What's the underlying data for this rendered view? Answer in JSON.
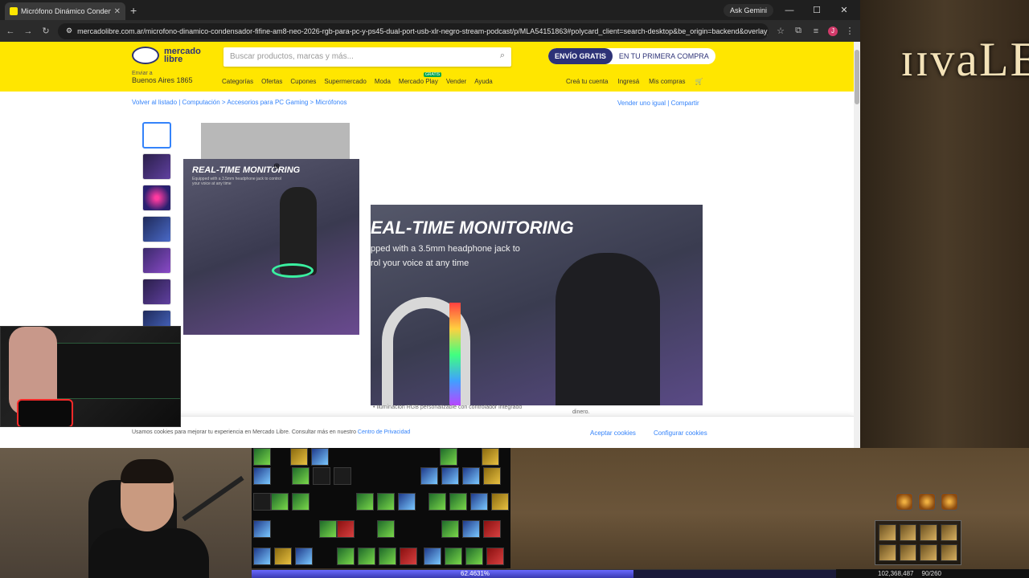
{
  "browser": {
    "tab_title": "Micrófono Dinámico Condensa...",
    "new_tab": "+",
    "gemini": "Ask Gemini",
    "url": "mercadolibre.com.ar/microfono-dinamico-condensador-fifine-am8-neo-2026-rgb-para-pc-y-ps45-dual-port-usb-xlr-negro-stream-podcast/p/MLA54151863#polycard_client=search-desktop&be_origin=backend&overlay_l...",
    "profile_initial": "J"
  },
  "ml": {
    "logo_text": "mercado libre",
    "search_placeholder": "Buscar productos, marcas y más...",
    "promo_1": "ENVÍO GRATIS",
    "promo_2": "EN TU PRIMERA COMPRA",
    "deliver_label": "Enviar a",
    "deliver_city": "Buenos Aires 1865",
    "nav": [
      "Categorías",
      "Ofertas",
      "Cupones",
      "Supermercado",
      "Moda",
      "Mercado Play",
      "Vender",
      "Ayuda"
    ],
    "gratis_badge": "GRATIS",
    "nav_right": [
      "Creá tu cuenta",
      "Ingresá",
      "Mis compras"
    ],
    "breadcrumb": "Volver al listado  |  Computación  >  Accesorios para PC Gaming  >  Micrófonos",
    "breadcrumb_right": "Vender uno igual  |  Compartir",
    "card_title": "REAL-TIME MONITORING",
    "card_sub": "Equipped with a 3.5mm headphone jack to control your voice at any time",
    "zoom_title": "EAL-TIME MONITORING",
    "zoom_sub_1": "pped with a 3.5mm headphone jack to",
    "zoom_sub_2": "rol your voice at any time",
    "below_text": "• Iluminación RGB personalizable con controlador integrado",
    "below_text2": "dinero.",
    "cookie_text": "Usamos cookies para mejorar tu experiencia en Mercado Libre. Consultar más en nuestro",
    "cookie_link": "Centro de Privacidad",
    "cookie_accept": "Aceptar cookies",
    "cookie_config": "Configurar cookies"
  },
  "game": {
    "logo": "ɪɪvaLE",
    "xp_percent": 62.4631,
    "xp_text": "62.4631%",
    "gold": "102,368,487",
    "bag": "90/260"
  }
}
